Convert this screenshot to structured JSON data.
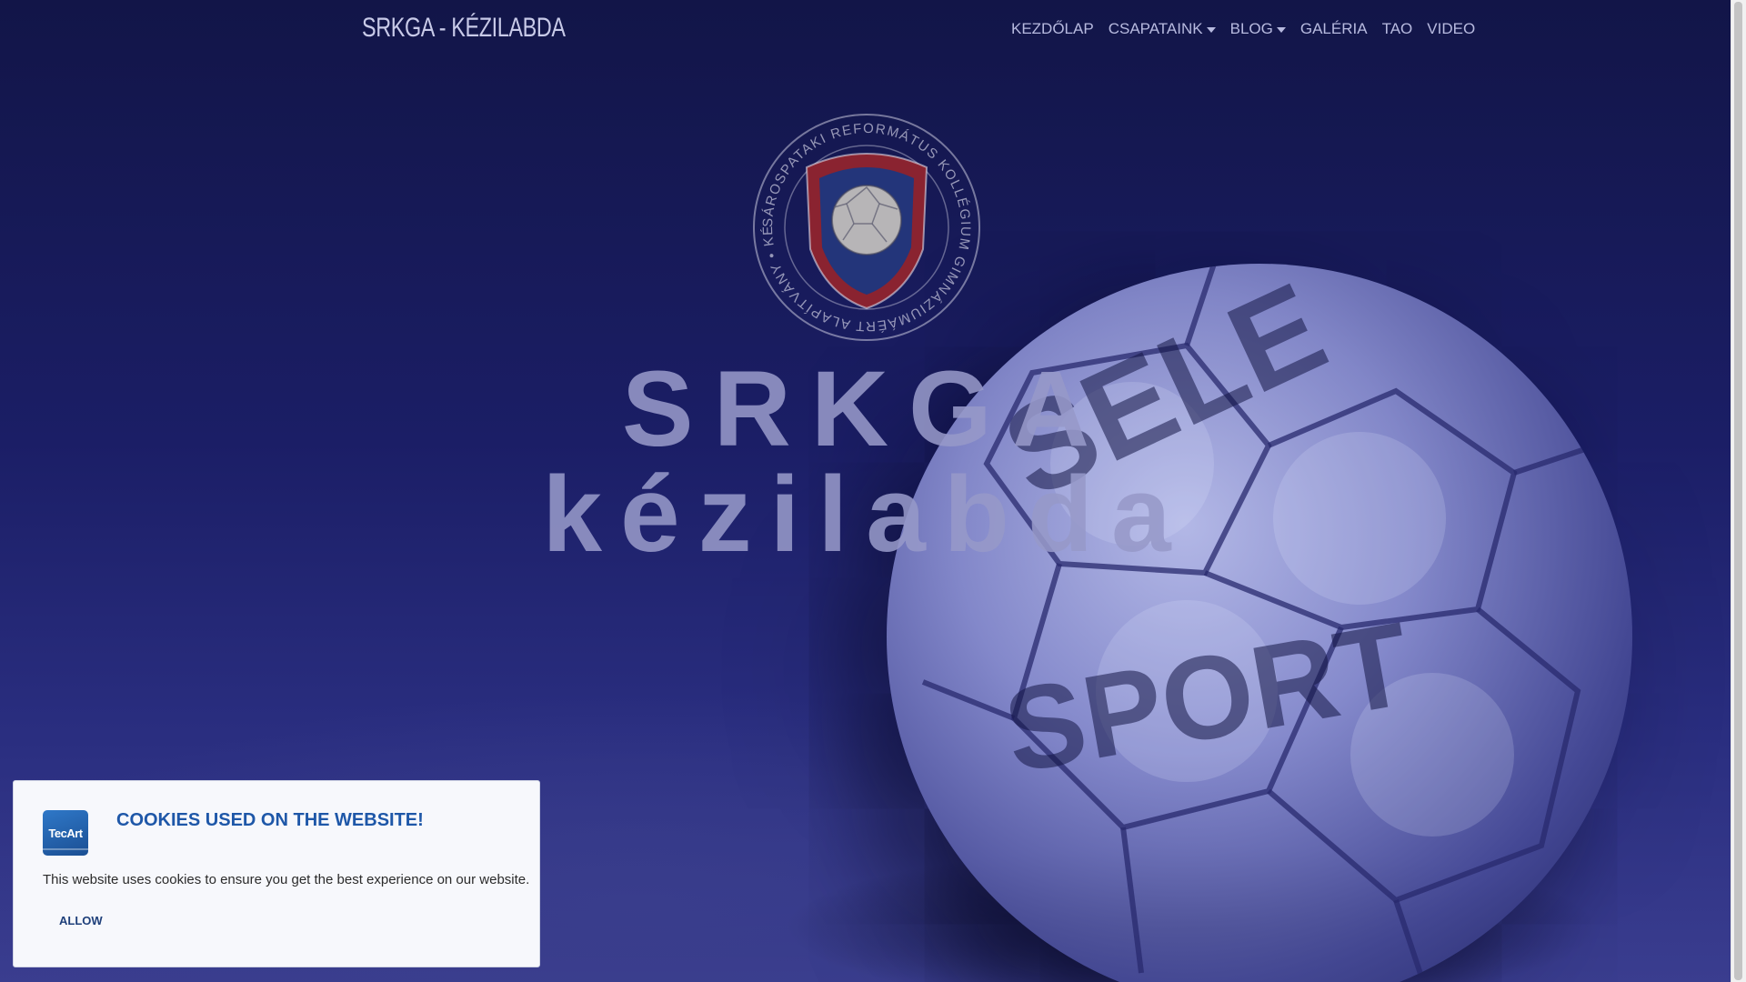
{
  "navbar": {
    "brand": "SRKGA - KÉZILABDA",
    "items": [
      {
        "label": "KEZDŐLAP",
        "dropdown": false
      },
      {
        "label": "CSAPATAINK",
        "dropdown": true
      },
      {
        "label": "BLOG",
        "dropdown": true
      },
      {
        "label": "GALÉRIA",
        "dropdown": false
      },
      {
        "label": "TAO",
        "dropdown": false
      },
      {
        "label": "VIDEO",
        "dropdown": false
      }
    ]
  },
  "hero": {
    "crest_ring_text": "SÁROSPATAKI REFORMÁTUS KOLLÉGIUM GIMNÁZIUMÁÉRT ALAPÍTVÁNY • KÉZILABDA •",
    "title_line1": "SRKGA",
    "title_line2": "kézilabda"
  },
  "cookie": {
    "logo_text": "TecArt",
    "title": "COOKIES USED ON THE WEBSITE!",
    "text": "This website uses cookies to ensure you get the best experience on our website.",
    "allow_label": "ALLOW"
  },
  "colors": {
    "overlay": "#171a5e",
    "cookie_title": "#1e57a8",
    "crest_red": "#b8302f",
    "crest_blue": "#2a3f8f"
  },
  "icons": {
    "crest": "handball-club-crest-icon",
    "cookie_logo": "tecart-logo-icon",
    "caret": "caret-down-icon"
  }
}
